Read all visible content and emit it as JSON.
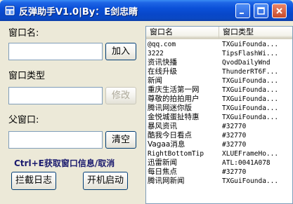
{
  "window": {
    "title": "反弹助手V1.0|By：E剑忠睛"
  },
  "form": {
    "window_name_label": "窗口名:",
    "window_name_value": "",
    "add_button": "加入",
    "window_class_label": "窗口类型",
    "window_class_value": "",
    "modify_button": "修改",
    "parent_window_label": "父窗口:",
    "parent_window_value": "",
    "clear_button": "清空",
    "hotkey_hint": "Ctrl+E获取窗口信息/取消",
    "intercept_log_button": "拦截日志",
    "startup_button": "开机启动"
  },
  "list": {
    "columns": [
      "窗口名",
      "窗口类型"
    ],
    "rows": [
      {
        "name": "@qq.com",
        "class": "TXGuiFounda..."
      },
      {
        "name": "3222",
        "class": "TipsFlashWi..."
      },
      {
        "name": "资讯快播",
        "class": "QvodDailyWnd"
      },
      {
        "name": "在线升级",
        "class": "ThunderRT6F..."
      },
      {
        "name": "新闻",
        "class": "TXGuiFounda..."
      },
      {
        "name": "重庆生活第一网",
        "class": "TXGuiFounda..."
      },
      {
        "name": "尊敬的拍拍用户",
        "class": "TXGuiFounda..."
      },
      {
        "name": "腾讯网迷你版",
        "class": "TXGuiFounda..."
      },
      {
        "name": "金悦城蛋扯特惠",
        "class": "TXGuiFounda..."
      },
      {
        "name": "暴风资讯",
        "class": "#32770"
      },
      {
        "name": "酷我今日看点",
        "class": "#32770"
      },
      {
        "name": "Vagaa消息",
        "class": "#32770"
      },
      {
        "name": "RightBottomTip",
        "class": "XLUEFrameHo..."
      },
      {
        "name": "迅雷新闻",
        "class": "ATL:0041A078"
      },
      {
        "name": "每日焦点",
        "class": "#32770"
      },
      {
        "name": "腾讯网新闻",
        "class": "TXGuiFounda..."
      }
    ]
  }
}
